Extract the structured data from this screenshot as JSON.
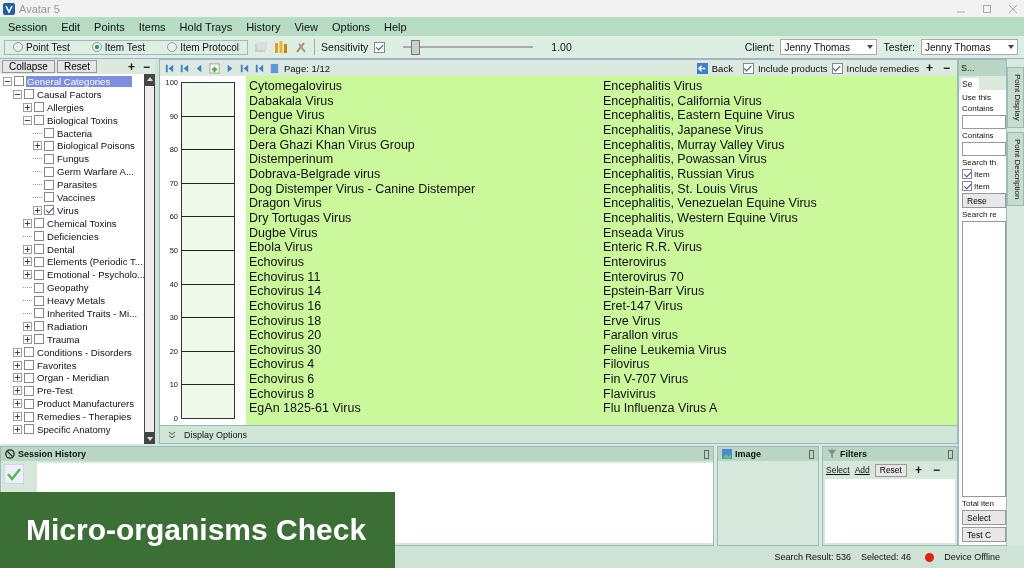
{
  "window": {
    "title": "Avatar 5"
  },
  "menu": [
    "Session",
    "Edit",
    "Points",
    "Items",
    "Hold Trays",
    "History",
    "View",
    "Options",
    "Help"
  ],
  "test_modes": [
    {
      "label": "Point Test",
      "selected": false
    },
    {
      "label": "Item Test",
      "selected": true
    },
    {
      "label": "Item Protocol",
      "selected": false
    }
  ],
  "sensitivity": {
    "label": "Sensitivity",
    "checked": true,
    "level": 0.06,
    "reading": "1.00"
  },
  "client": {
    "label": "Client:",
    "value": "Jenny Thomas"
  },
  "tester": {
    "label": "Tester:",
    "value": "Jenny Thomas"
  },
  "tree_header": {
    "buttons": [
      "Collapse",
      "Reset"
    ],
    "expand": "+",
    "collapse": "−"
  },
  "tree": [
    {
      "label": "General Categories",
      "kind": "branch",
      "expanded": true,
      "checked": false,
      "selected": true,
      "children": [
        {
          "label": "Causal Factors",
          "kind": "branch",
          "expanded": true,
          "checked": false,
          "selected": false,
          "children": [
            {
              "label": "Allergies",
              "kind": "branch",
              "expanded": false,
              "checked": false,
              "selected": false
            },
            {
              "label": "Biological Toxins",
              "kind": "branch",
              "expanded": true,
              "checked": false,
              "selected": false,
              "children": [
                {
                  "label": "Bacteria",
                  "kind": "leaf",
                  "checked": false,
                  "selected": false
                },
                {
                  "label": "Biological Poisons",
                  "kind": "branch",
                  "expanded": false,
                  "checked": false,
                  "selected": false
                },
                {
                  "label": "Fungus",
                  "kind": "leaf",
                  "checked": false,
                  "selected": false
                },
                {
                  "label": "Germ Warfare A...",
                  "kind": "leaf",
                  "checked": false,
                  "selected": false
                },
                {
                  "label": "Parasites",
                  "kind": "leaf",
                  "checked": false,
                  "selected": false
                },
                {
                  "label": "Vaccines",
                  "kind": "leaf",
                  "checked": false,
                  "selected": false
                },
                {
                  "label": "Virus",
                  "kind": "branch",
                  "expanded": false,
                  "checked": true,
                  "selected": false
                }
              ]
            },
            {
              "label": "Chemical Toxins",
              "kind": "branch",
              "expanded": false,
              "checked": false,
              "selected": false
            },
            {
              "label": "Deficiencies",
              "kind": "leaf",
              "checked": false,
              "selected": false
            },
            {
              "label": "Dental",
              "kind": "branch",
              "expanded": false,
              "checked": false,
              "selected": false
            },
            {
              "label": "Elements (Periodic T...",
              "kind": "branch",
              "expanded": false,
              "checked": false,
              "selected": false
            },
            {
              "label": "Emotional - Psycholo...",
              "kind": "branch",
              "expanded": false,
              "checked": false,
              "selected": false
            },
            {
              "label": "Geopathy",
              "kind": "leaf",
              "checked": false,
              "selected": false
            },
            {
              "label": "Heavy Metals",
              "kind": "leaf",
              "checked": false,
              "selected": false
            },
            {
              "label": "Inherited Traits - Mi...",
              "kind": "leaf",
              "checked": false,
              "selected": false
            },
            {
              "label": "Radiation",
              "kind": "branch",
              "expanded": false,
              "checked": false,
              "selected": false
            },
            {
              "label": "Trauma",
              "kind": "branch",
              "expanded": false,
              "checked": false,
              "selected": false
            }
          ]
        },
        {
          "label": "Conditions - Disorders",
          "kind": "branch",
          "expanded": false,
          "checked": false,
          "selected": false
        },
        {
          "label": "Favorites",
          "kind": "branch",
          "expanded": false,
          "checked": false,
          "selected": false
        },
        {
          "label": "Organ - Meridian",
          "kind": "branch",
          "expanded": false,
          "checked": false,
          "selected": false
        },
        {
          "label": "Pre-Test",
          "kind": "branch",
          "expanded": false,
          "checked": false,
          "selected": false
        },
        {
          "label": "Product Manufacturers",
          "kind": "branch",
          "expanded": false,
          "checked": false,
          "selected": false
        },
        {
          "label": "Remedies - Therapies",
          "kind": "branch",
          "expanded": false,
          "checked": false,
          "selected": false
        },
        {
          "label": "Specific Anatomy",
          "kind": "branch",
          "expanded": false,
          "checked": false,
          "selected": false
        }
      ]
    }
  ],
  "navigation": {
    "page": "Page: 1/12",
    "back": "Back",
    "include_products": {
      "label": "Include products",
      "checked": true
    },
    "include_remedies": {
      "label": "Include remedies",
      "checked": true
    },
    "expand": "+",
    "collapse": "−"
  },
  "gauge": {
    "scale": [
      "100",
      "90",
      "80",
      "70",
      "60",
      "50",
      "40",
      "30",
      "20",
      "10",
      "0"
    ]
  },
  "items": [
    [
      "Cytomegalovirus",
      "Dabakala Virus",
      "Dengue Virus",
      "Dera Ghazi Khan Virus",
      "Dera Ghazi Khan Virus Group",
      "Distemperinum",
      "Dobrava-Belgrade virus",
      "Dog Distemper Virus - Canine Distemper",
      "Dragon Virus",
      "Dry Tortugas Virus",
      "Dugbe Virus",
      "Ebola Virus",
      "Echovirus",
      "Echovirus 11",
      "Echovirus 14",
      "Echovirus 16",
      "Echovirus 18",
      "Echovirus 20",
      "Echovirus 30",
      "Echovirus 4",
      "Echovirus 6",
      "Echovirus 8",
      "EgAn 1825-61 Virus"
    ],
    [
      "Encephalitis Virus",
      "Encephalitis, California Virus",
      "Encephalitis, Eastern Equine Virus",
      "Encephalitis, Japanese Virus",
      "Encephalitis, Murray Valley Virus",
      "Encephalitis, Powassan Virus",
      "Encephalitis, Russian  Virus",
      "Encephalitis, St. Louis Virus",
      "Encephalitis, Venezuelan Equine Virus",
      "Encephalitis, Western Equine Virus",
      "Enseada Virus",
      "Enteric R.R. Virus",
      "Enterovirus",
      "Enterovirus 70",
      "Epstein-Barr Virus",
      "Eret-147 Virus",
      "Erve Virus",
      "Farallon virus",
      "Feline Leukemia Virus",
      "Filovirus",
      "Fin V-707 Virus",
      "Flavivirus",
      "Flu Influenza Virus A"
    ]
  ],
  "display_options": "Display Options",
  "search_panel": {
    "title": "S...",
    "tab": "Se",
    "intro": "Use this",
    "contains_1": "Contains",
    "contains_2": "Contains",
    "search_label": "Search th",
    "options": [
      {
        "label": "Item",
        "checked": true
      },
      {
        "label": "Item",
        "checked": true
      }
    ],
    "reset": "Rese",
    "results_label": "Search re",
    "total": "Total iten",
    "select": "Select",
    "test": "Test C"
  },
  "side_tabs": [
    "Point Display",
    "Point Description"
  ],
  "session_history": {
    "title": "Session History"
  },
  "image_panel": {
    "title": "Image"
  },
  "filters": {
    "title": "Filters",
    "select": "Select",
    "add": "Add",
    "reset": "Reset",
    "expand": "+",
    "collapse": "−"
  },
  "status_bar": {
    "search_result": "Search Result: 536",
    "selected": "Selected: 46",
    "device": "Device Offline"
  },
  "caption": "Micro-organisms Check"
}
